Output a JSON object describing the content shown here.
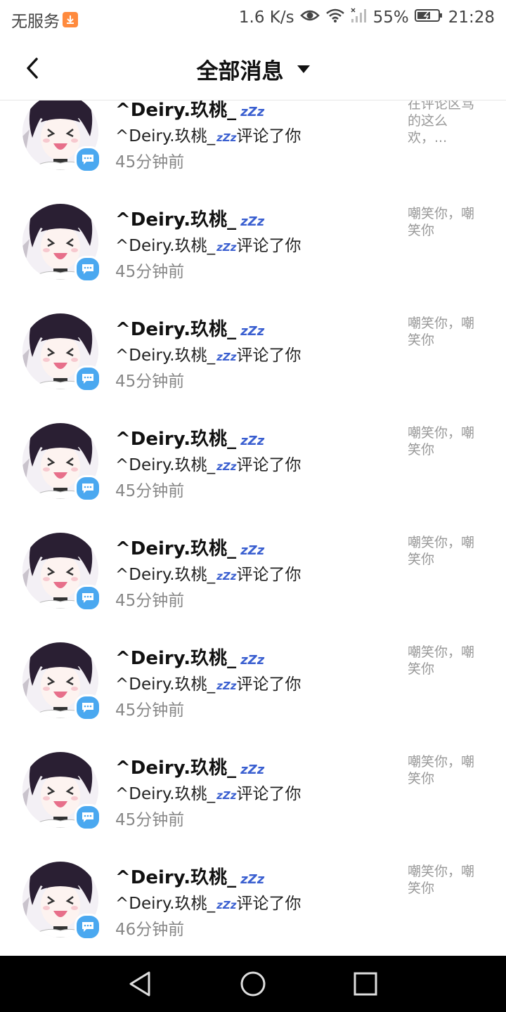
{
  "status_bar": {
    "carrier": "无服务",
    "speed": "1.6 K/s",
    "battery": "55%",
    "time": "21:28",
    "icons": [
      "download-icon",
      "eye-icon",
      "wifi-icon",
      "signal-icon",
      "battery-icon"
    ]
  },
  "header": {
    "title": "全部消息",
    "back_icon": "chevron-left-icon",
    "dropdown_icon": "caret-down-icon"
  },
  "notifications": [
    {
      "name": "^Deiry.玖桃_",
      "action": "^Deiry.玖桃_",
      "action_suffix": "评论了你",
      "time": "45分钟前",
      "snippet": "在评论区骂的这么欢，..."
    },
    {
      "name": "^Deiry.玖桃_",
      "action": "^Deiry.玖桃_",
      "action_suffix": "评论了你",
      "time": "45分钟前",
      "snippet": "嘲笑你，嘲笑你"
    },
    {
      "name": "^Deiry.玖桃_",
      "action": "^Deiry.玖桃_",
      "action_suffix": "评论了你",
      "time": "45分钟前",
      "snippet": "嘲笑你，嘲笑你"
    },
    {
      "name": "^Deiry.玖桃_",
      "action": "^Deiry.玖桃_",
      "action_suffix": "评论了你",
      "time": "45分钟前",
      "snippet": "嘲笑你，嘲笑你"
    },
    {
      "name": "^Deiry.玖桃_",
      "action": "^Deiry.玖桃_",
      "action_suffix": "评论了你",
      "time": "45分钟前",
      "snippet": "嘲笑你，嘲笑你"
    },
    {
      "name": "^Deiry.玖桃_",
      "action": "^Deiry.玖桃_",
      "action_suffix": "评论了你",
      "time": "45分钟前",
      "snippet": "嘲笑你，嘲笑你"
    },
    {
      "name": "^Deiry.玖桃_",
      "action": "^Deiry.玖桃_",
      "action_suffix": "评论了你",
      "time": "45分钟前",
      "snippet": "嘲笑你，嘲笑你"
    },
    {
      "name": "^Deiry.玖桃_",
      "action": "^Deiry.玖桃_",
      "action_suffix": "评论了你",
      "time": "46分钟前",
      "snippet": "嘲笑你，嘲笑你"
    }
  ],
  "nav_bar": {
    "icons": [
      "back-triangle-icon",
      "home-circle-icon",
      "recents-square-icon"
    ]
  },
  "colors": {
    "badge": "#4aa8f0",
    "zzz": "#3a5fd0",
    "muted_text": "#888888",
    "snippet_text": "#999999"
  }
}
